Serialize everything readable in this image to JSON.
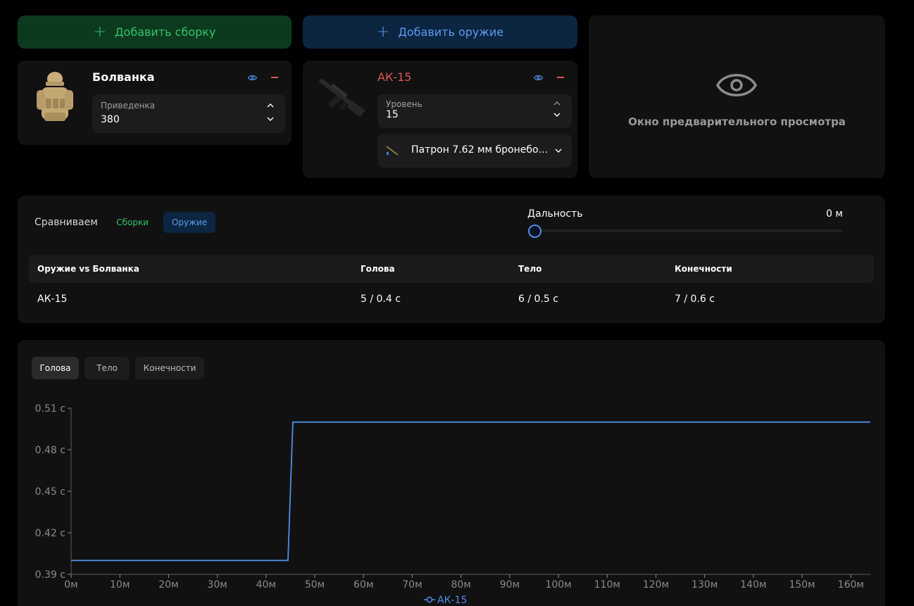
{
  "top": {
    "add_build_label": "Добавить сборку",
    "add_weapon_label": "Добавить оружие"
  },
  "build_card": {
    "title": "Болванка",
    "field_label": "Приведенка",
    "field_value": "380"
  },
  "weapon_card": {
    "title": "АК-15",
    "level_label": "Уровень",
    "level_value": "15",
    "ammo_value": "Патрон 7.62 мм бронебо..."
  },
  "preview": {
    "text": "Окно предварительного просмотра"
  },
  "compare": {
    "label": "Сравниваем",
    "tab_builds": "Сборки",
    "tab_weapons": "Оружие",
    "range_label": "Дальность",
    "range_value": "0 м",
    "range_fraction": 0
  },
  "table": {
    "headers": [
      "Оружие vs Болванка",
      "Голова",
      "Тело",
      "Конечности"
    ],
    "rows": [
      [
        "АК-15",
        "5 / 0.4 с",
        "6 / 0.5 с",
        "7 / 0.6 с"
      ]
    ]
  },
  "chart_tabs": [
    "Голова",
    "Тело",
    "Конечности"
  ],
  "colors": {
    "accent_green": "#35c46a",
    "accent_blue": "#5b9cf0",
    "weapon_title": "#e0584f",
    "line": "#4f8fe6"
  },
  "chart_data": {
    "type": "line",
    "x_ticks": [
      "0м",
      "10м",
      "20м",
      "30м",
      "40м",
      "50м",
      "60м",
      "70м",
      "80м",
      "90м",
      "100м",
      "110м",
      "120м",
      "130м",
      "140м",
      "150м",
      "160м"
    ],
    "y_ticks": [
      "0.39 с",
      "0.42 с",
      "0.45 с",
      "0.48 с",
      "0.51 с"
    ],
    "ylim": [
      0.39,
      0.51
    ],
    "xlim": [
      0,
      164
    ],
    "series": [
      {
        "name": "АК-15",
        "x": [
          0,
          44.5,
          45.5,
          164
        ],
        "y": [
          0.4,
          0.4,
          0.5,
          0.5
        ]
      }
    ]
  }
}
